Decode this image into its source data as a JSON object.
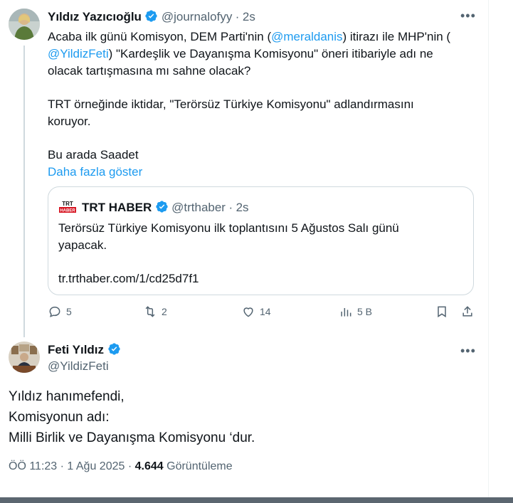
{
  "tweet1": {
    "author_name": "Yıldız Yazıcıoğlu",
    "handle": "@journalofyy",
    "separator": "·",
    "time": "2s",
    "line1_a": "Acaba ilk günü Komisyon, DEM Parti'nin (",
    "mention1": "@meraldanis",
    "line1_b": ") itirazı ile MHP'nin (",
    "mention2": "@YildizFeti",
    "line2_b": ") \"Kardeşlik ve Dayanışma Komisyonu\" öneri itibariyle adı ne",
    "line3": "olacak tartışmasına mı sahne olacak?",
    "para2_line1": "TRT örneğinde iktidar, \"Terörsüz Türkiye Komisyonu\" adlandırmasını",
    "para2_line2": "koruyor.",
    "para3": "Bu arada Saadet",
    "show_more": "Daha fazla göster",
    "quote": {
      "logo_text": "TRT HABER",
      "author_name": "TRT HABER",
      "handle": "@trthaber",
      "separator": "·",
      "time": "2s",
      "line1": "Terörsüz Türkiye Komisyonu ilk toplantısını 5 Ağustos Salı günü",
      "line2": "yapacak.",
      "url": "tr.trthaber.com/1/cd25d7f1"
    },
    "actions": {
      "replies": "5",
      "retweets": "2",
      "likes": "14",
      "views": "5 B"
    }
  },
  "tweet2": {
    "author_name": "Feti Yıldız",
    "handle": "@YildizFeti",
    "line1": "Yıldız hanımefendi,",
    "line2": "Komisyonun adı:",
    "line3": "Milli Birlik ve Dayanışma Komisyonu ‘dur.",
    "time": "ÖÖ 11:23",
    "dot": "·",
    "date": "1 Ağu 2025",
    "dot2": "·",
    "views_count": "4.644",
    "views_label": "Görüntüleme"
  },
  "colors": {
    "link": "#1d9bf0",
    "muted": "#536471",
    "verified": "#1d9bf0",
    "trt_red": "#d6111e"
  },
  "more_icon": "ellipsis-icon"
}
